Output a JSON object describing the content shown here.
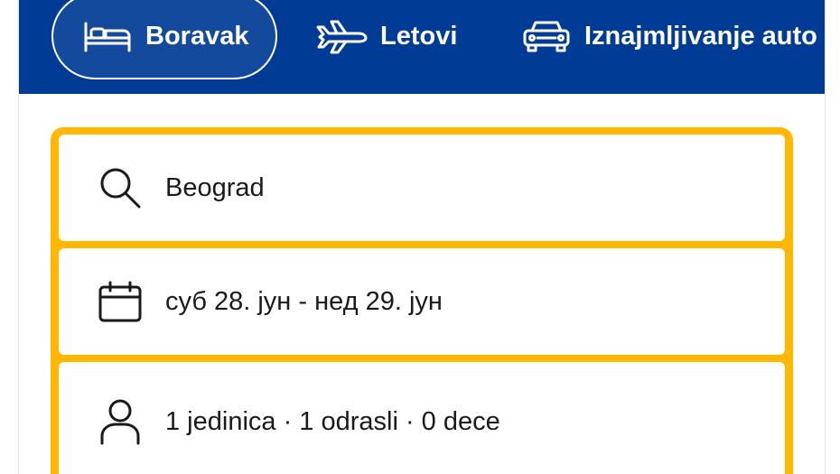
{
  "nav": {
    "tabs": [
      {
        "label": "Boravak",
        "icon": "bed-icon",
        "active": true
      },
      {
        "label": "Letovi",
        "icon": "airplane-icon",
        "active": false
      },
      {
        "label": "Iznajmljivanje auto",
        "icon": "car-icon",
        "active": false
      }
    ]
  },
  "search": {
    "destination": "Beograd",
    "dates": "суб 28. јун - нед 29. јун",
    "occupancy": "1 jedinica · 1 odrasli · 0 dece"
  },
  "colors": {
    "nav_background": "#003b95",
    "search_border": "#ffb700",
    "text": "#1a1a1a"
  }
}
